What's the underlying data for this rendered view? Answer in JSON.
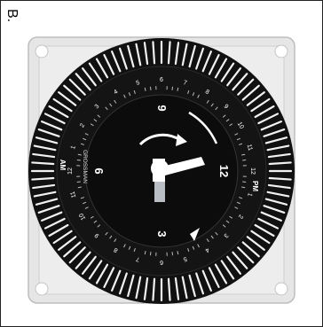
{
  "panel": {
    "label": "B."
  },
  "timer": {
    "brand": "GROSSMAN",
    "dial_numbers": [
      "12",
      "3",
      "6",
      "9"
    ],
    "period_labels": [
      "AM",
      "PM"
    ],
    "hour_scale": [
      "12",
      "1",
      "2",
      "3",
      "4",
      "5",
      "6",
      "7",
      "8",
      "9",
      "10",
      "11",
      "12",
      "1",
      "2",
      "3",
      "4",
      "5",
      "6",
      "7",
      "8",
      "9",
      "10",
      "11"
    ],
    "colors": {
      "housing": "#e6e6e6",
      "dial": "#111111",
      "pins": "#f2f2f2",
      "hands": "#ffffff",
      "indicator": "#b9bec4"
    },
    "icons": [
      "rotation-arrow-icon",
      "time-pointer-icon"
    ]
  }
}
